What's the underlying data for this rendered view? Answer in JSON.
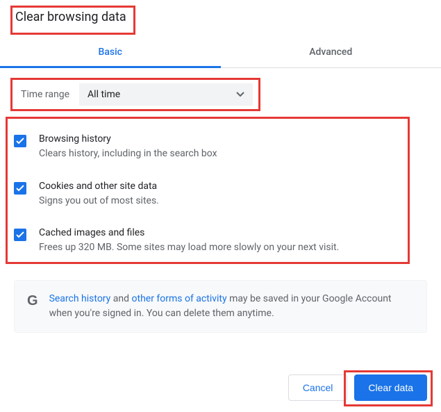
{
  "title": "Clear browsing data",
  "tabs": {
    "basic": "Basic",
    "advanced": "Advanced"
  },
  "timerange": {
    "label": "Time range",
    "value": "All time"
  },
  "options": [
    {
      "title": "Browsing history",
      "desc": "Clears history, including in the search box"
    },
    {
      "title": "Cookies and other site data",
      "desc": "Signs you out of most sites."
    },
    {
      "title": "Cached images and files",
      "desc": "Frees up 320 MB. Some sites may load more slowly on your next visit."
    }
  ],
  "info": {
    "link1": "Search history",
    "mid1": " and ",
    "link2": "other forms of activity",
    "rest": " may be saved in your Google Account when you're signed in. You can delete them anytime."
  },
  "buttons": {
    "cancel": "Cancel",
    "clear": "Clear data"
  }
}
